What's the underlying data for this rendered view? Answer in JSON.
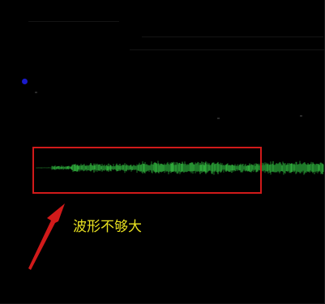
{
  "colors": {
    "background": "#000000",
    "waveform": "#1f7a2a",
    "waveform_bright": "#2fa83a",
    "highlight": "#d11a1a",
    "arrow": "#d11a1a",
    "annotation_text": "#e8e020",
    "track_dot": "#1a1acc"
  },
  "annotation": {
    "text": "波形不够大"
  },
  "icons": {
    "track_marker": "dot-icon",
    "pointer": "arrow-icon"
  }
}
